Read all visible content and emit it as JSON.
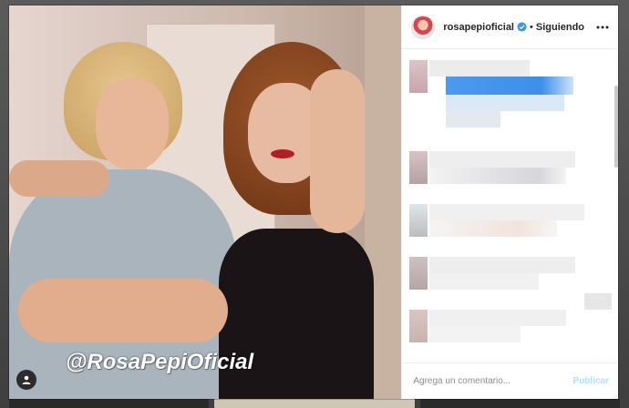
{
  "post": {
    "watermark": "@RosaPepiOficial",
    "tag_icon": "user-tag-icon"
  },
  "header": {
    "username": "rosapepioficial",
    "verified_icon": "verified-badge-icon",
    "separator": "•",
    "follow_state": "Siguiendo",
    "more_icon": "more-options-icon"
  },
  "comment_box": {
    "placeholder": "Agrega un comentario...",
    "post_label": "Publicar"
  },
  "colors": {
    "verified": "#3897f0",
    "post_button": "#b2dffc",
    "pixelated_highlight": "#4a9af0"
  }
}
